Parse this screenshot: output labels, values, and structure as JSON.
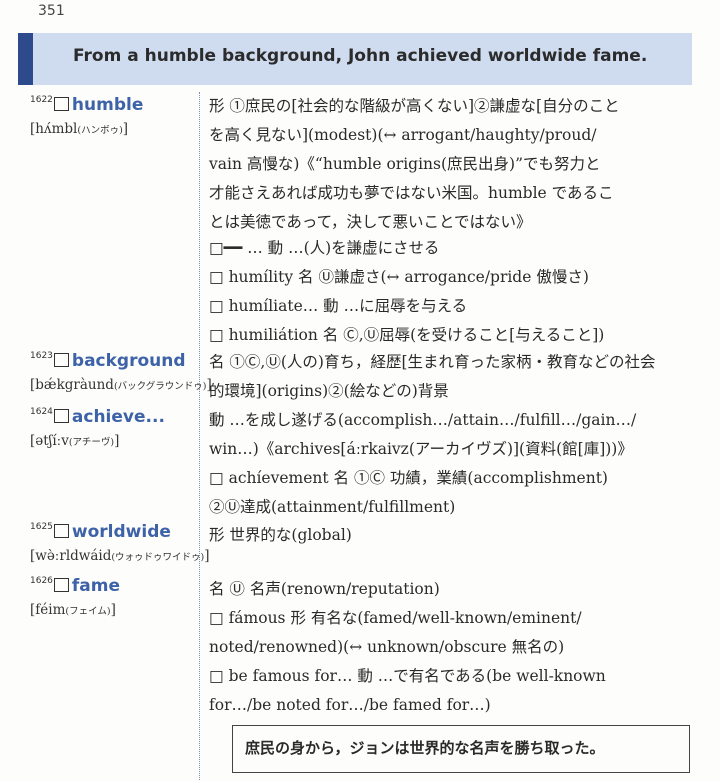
{
  "page_number": "351",
  "title": "From a humble background, John achieved worldwide fame.",
  "entries": [
    {
      "num": "1622",
      "word": "humble",
      "pron": "[hʌ́mbl",
      "kana": "(ハンボゥ)",
      "pron_end": "]"
    },
    {
      "num": "1623",
      "word": "background",
      "pron": "[bǽkgràund",
      "kana": "(バックグラウンドゥ)",
      "pron_end": "]"
    },
    {
      "num": "1624",
      "word": "achieve...",
      "pron": "[ətʃíːv",
      "kana": "(アチーヴ)",
      "pron_end": "]"
    },
    {
      "num": "1625",
      "word": "worldwide",
      "pron": "[wə̀ːrldwáid",
      "kana": "(ウォゥドゥワイドゥ)",
      "pron_end": "]"
    },
    {
      "num": "1626",
      "word": "fame",
      "pron": "[féim",
      "kana": "(フェイム)",
      "pron_end": "]"
    }
  ],
  "lines": [
    "形 ①庶民の[社会的な階級が高くない]②謙虚な[自分のこと",
    "を高く見ない](modest)(↔ arrogant/haughty/proud/",
    "vain 高慢な)《“humble origins(庶民出身)”でも努力と",
    "才能さえあれば成功も夢ではない米国。humble であるこ",
    "とは美徳であって，決して悪いことではない》",
    "□━━ … 動 …(人)を謙虚にさせる",
    "□ humílity 名 Ⓤ謙虚さ(↔ arrogance/pride 傲慢さ)",
    "□ humíliate… 動 …に屈辱を与える",
    "□ humiliátion 名 Ⓒ,Ⓤ屈辱(を受けること[与えること])",
    "名 ①Ⓒ,Ⓤ(人の)育ち，経歴[生まれ育った家柄・教育などの社会",
    "的環境](origins)②(絵などの)背景",
    "動 …を成し遂げる(accomplish…/attain…/fulfill…/gain…/",
    "win…)《archives[áːrkaivz(アーカイヴズ)](資料(館[庫]))》",
    "□ achíevement 名 ①Ⓒ 功績，業績(accomplishment)",
    "②Ⓤ達成(attainment/fulfillment)",
    "形 世界的な(global)",
    "名 Ⓤ 名声(renown/reputation)",
    "□ fámous 形 有名な(famed/well-known/eminent/",
    "noted/renowned)(↔ unknown/obscure 無名の)",
    "□ be famous for… 動 …で有名である(be well-known",
    "for…/be noted for…/be famed for…)"
  ],
  "summary": "庶民の身から，ジョンは世界的な名声を勝ち取った。"
}
